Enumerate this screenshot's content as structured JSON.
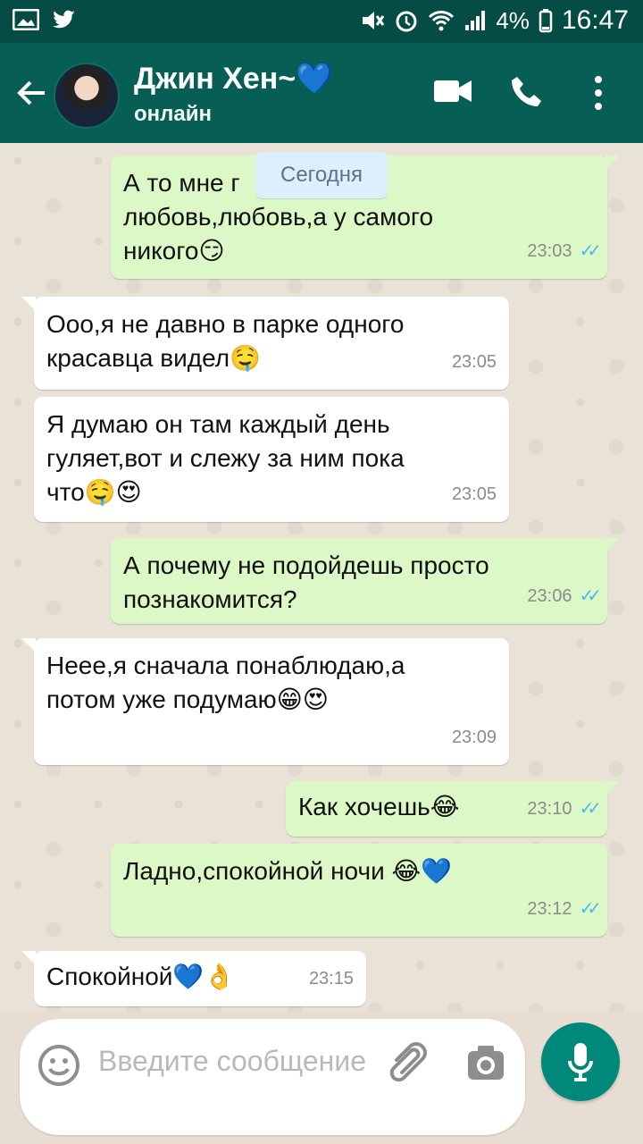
{
  "statusbar": {
    "battery": "4%",
    "time": "16:47",
    "icons": [
      "gallery-icon",
      "twitter-icon",
      "mute-icon",
      "alarm-icon",
      "wifi-icon",
      "signal-icon",
      "battery-icon"
    ]
  },
  "header": {
    "name": "Джин Хен~💙",
    "status": "онлайн",
    "icons": [
      "back-arrow-icon",
      "avatar",
      "video-call-icon",
      "phone-icon",
      "menu-dots-icon"
    ]
  },
  "chat": {
    "date_label": "Сегодня",
    "messages": [
      {
        "dir": "out",
        "text": "А то мне г                  любовь,любовь,а у самого никого😏",
        "time": "23:03",
        "ticks": "✓✓"
      },
      {
        "dir": "in",
        "text": "Ооо,я не давно в парке одного красавца видел🤤",
        "time": "23:05"
      },
      {
        "dir": "in",
        "text": "Я думаю он там каждый день гуляет,вот и слежу за ним пока что🤤😍",
        "time": "23:05"
      },
      {
        "dir": "out",
        "text": "А почему не подойдешь просто познакомится?",
        "time": "23:06",
        "ticks": "✓✓"
      },
      {
        "dir": "in",
        "text": "Неее,я сначала понаблюдаю,а потом уже подумаю😁😍",
        "time": "23:09"
      },
      {
        "dir": "out",
        "text": "Как хочешь😂",
        "time": "23:10",
        "ticks": "✓✓"
      },
      {
        "dir": "out",
        "text": "Ладно,спокойной ночи 😂💙",
        "time": "23:12",
        "ticks": "✓✓"
      },
      {
        "dir": "in",
        "text": "Спокойной💙👌",
        "time": "23:15"
      }
    ]
  },
  "input": {
    "placeholder": "Введите сообщение"
  },
  "colors": {
    "header": "#075e54",
    "statusbar": "#054c44",
    "outgoing": "#dcf8c6",
    "incoming": "#ffffff",
    "mic": "#00897b"
  }
}
